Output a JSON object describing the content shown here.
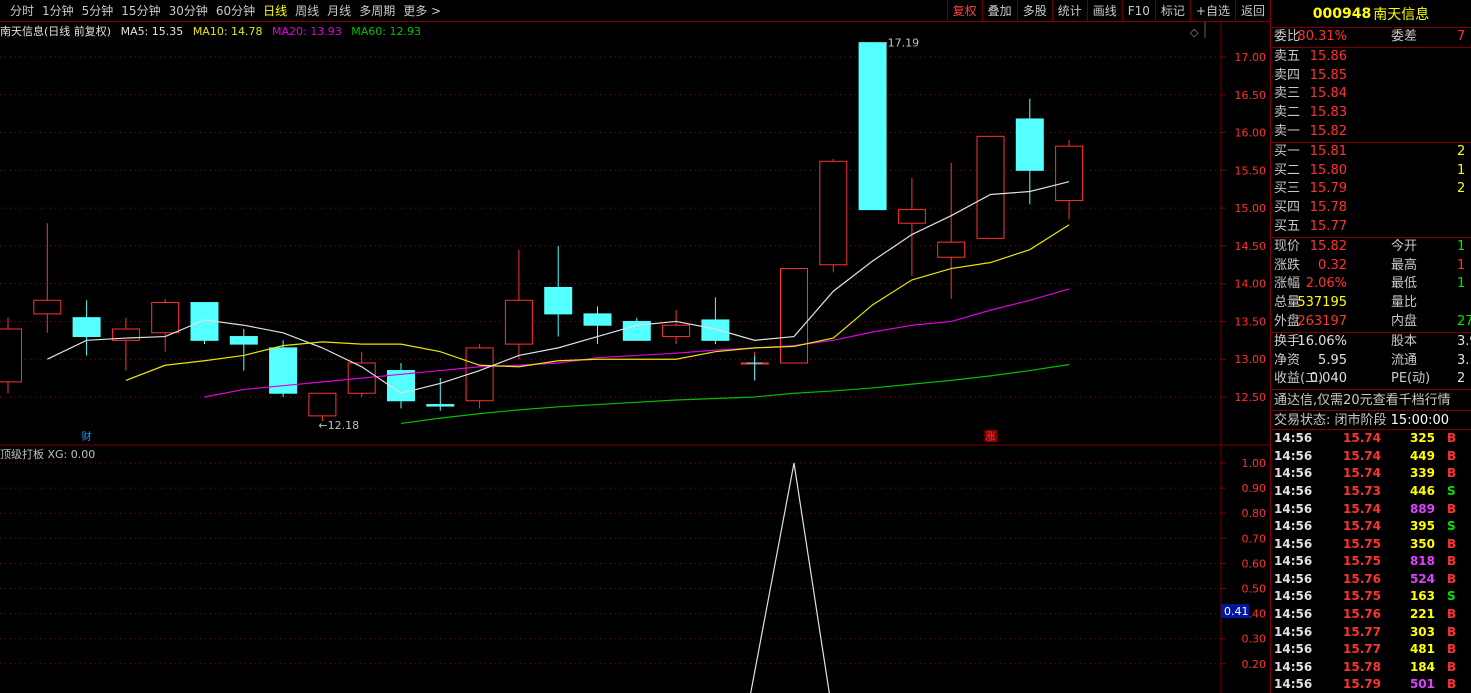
{
  "toolbar": {
    "periods": [
      {
        "label": "分时",
        "active": false
      },
      {
        "label": "1分钟",
        "active": false
      },
      {
        "label": "5分钟",
        "active": false
      },
      {
        "label": "15分钟",
        "active": false
      },
      {
        "label": "30分钟",
        "active": false
      },
      {
        "label": "60分钟",
        "active": false
      },
      {
        "label": "日线",
        "active": true
      },
      {
        "label": "周线",
        "active": false
      },
      {
        "label": "月线",
        "active": false
      },
      {
        "label": "多周期",
        "active": false
      },
      {
        "label": "更多 >",
        "active": false
      }
    ],
    "tools": [
      {
        "label": "复权",
        "active": true
      },
      {
        "label": "叠加",
        "active": false
      },
      {
        "label": "多股",
        "active": false
      },
      {
        "label": "统计",
        "active": false
      },
      {
        "label": "画线",
        "active": false
      },
      {
        "label": "F10",
        "active": false
      },
      {
        "label": "标记",
        "active": false
      },
      {
        "label": "+自选",
        "active": false
      },
      {
        "label": "返回",
        "active": false
      }
    ]
  },
  "legend": {
    "title": "南天信息(日线 前复权)",
    "ma5": "MA5: 15.35",
    "ma10": "MA10: 14.78",
    "ma20": "MA20: 13.93",
    "ma60": "MA60: 12.93"
  },
  "sub_legend": {
    "title": "顶级打板",
    "value": "XG: 0.00"
  },
  "colors": {
    "up": "#ff3232",
    "down": "#54ffff",
    "ma5": "#e0e0e0",
    "ma10": "#e6e600",
    "ma20": "#e000e0",
    "ma60": "#00c000",
    "axis_border": "#800000",
    "grid": "#8c0000"
  },
  "chart_data": [
    {
      "type": "candlestick",
      "title": "南天信息(日线 前复权)",
      "ylim": [
        12.0,
        17.3
      ],
      "yticks": [
        "17.00",
        "16.50",
        "16.00",
        "15.50",
        "15.00",
        "14.50",
        "14.00",
        "13.50",
        "13.00",
        "12.50"
      ],
      "candles": [
        {
          "o": 12.7,
          "h": 13.55,
          "l": 12.55,
          "c": 13.4
        },
        {
          "o": 13.6,
          "h": 14.8,
          "l": 13.35,
          "c": 13.78
        },
        {
          "o": 13.55,
          "h": 13.78,
          "l": 13.05,
          "c": 13.3
        },
        {
          "o": 13.25,
          "h": 13.55,
          "l": 12.85,
          "c": 13.4
        },
        {
          "o": 13.35,
          "h": 13.8,
          "l": 13.1,
          "c": 13.75
        },
        {
          "o": 13.75,
          "h": 13.75,
          "l": 13.2,
          "c": 13.25
        },
        {
          "o": 13.3,
          "h": 13.4,
          "l": 12.85,
          "c": 13.2
        },
        {
          "o": 13.15,
          "h": 13.25,
          "l": 12.5,
          "c": 12.55
        },
        {
          "o": 12.25,
          "h": 12.55,
          "l": 12.18,
          "c": 12.55
        },
        {
          "o": 12.55,
          "h": 13.1,
          "l": 12.5,
          "c": 12.95
        },
        {
          "o": 12.85,
          "h": 12.95,
          "l": 12.35,
          "c": 12.45
        },
        {
          "o": 12.4,
          "h": 12.75,
          "l": 12.32,
          "c": 12.38
        },
        {
          "o": 12.45,
          "h": 13.2,
          "l": 12.35,
          "c": 13.15
        },
        {
          "o": 13.2,
          "h": 14.45,
          "l": 13.0,
          "c": 13.78
        },
        {
          "o": 13.95,
          "h": 14.5,
          "l": 13.3,
          "c": 13.6
        },
        {
          "o": 13.6,
          "h": 13.7,
          "l": 13.2,
          "c": 13.45
        },
        {
          "o": 13.5,
          "h": 13.55,
          "l": 13.25,
          "c": 13.25
        },
        {
          "o": 13.3,
          "h": 13.65,
          "l": 13.2,
          "c": 13.45
        },
        {
          "o": 13.52,
          "h": 13.82,
          "l": 13.2,
          "c": 13.25
        },
        {
          "o": 12.95,
          "h": 13.1,
          "l": 12.72,
          "c": 12.95
        },
        {
          "o": 12.95,
          "h": 14.2,
          "l": 12.95,
          "c": 14.2
        },
        {
          "o": 14.25,
          "h": 15.65,
          "l": 14.15,
          "c": 15.62
        },
        {
          "o": 17.19,
          "h": 17.19,
          "l": 14.98,
          "c": 14.98
        },
        {
          "o": 14.8,
          "h": 15.4,
          "l": 14.1,
          "c": 14.98
        },
        {
          "o": 14.35,
          "h": 15.6,
          "l": 13.8,
          "c": 14.55
        },
        {
          "o": 14.6,
          "h": 15.95,
          "l": 14.6,
          "c": 15.95
        },
        {
          "o": 16.18,
          "h": 16.45,
          "l": 15.05,
          "c": 15.5
        },
        {
          "o": 15.1,
          "h": 15.9,
          "l": 14.85,
          "c": 15.82
        }
      ],
      "ma5": [
        13.0,
        13.25,
        13.28,
        13.3,
        13.52,
        13.45,
        13.35,
        13.15,
        12.9,
        12.55,
        12.68,
        12.85,
        13.05,
        13.15,
        13.3,
        13.45,
        13.5,
        13.4,
        13.25,
        13.3,
        13.9,
        14.3,
        14.65,
        14.9,
        15.18,
        15.22,
        15.35
      ],
      "ma10": [
        12.72,
        12.92,
        12.98,
        13.05,
        13.18,
        13.23,
        13.2,
        13.2,
        13.1,
        12.92,
        12.9,
        12.98,
        13.0,
        13.0,
        13.0,
        13.1,
        13.15,
        13.17,
        13.28,
        13.72,
        14.05,
        14.2,
        14.28,
        14.45,
        14.78
      ],
      "ma20": [
        12.5,
        12.6,
        12.65,
        12.7,
        12.75,
        12.8,
        12.85,
        12.9,
        12.92,
        12.95,
        13.02,
        13.05,
        13.08,
        13.12,
        13.15,
        13.18,
        13.25,
        13.36,
        13.45,
        13.5,
        13.65,
        13.78,
        13.93
      ],
      "ma60": [
        12.15,
        12.22,
        12.28,
        12.33,
        12.37,
        12.4,
        12.43,
        12.46,
        12.48,
        12.5,
        12.55,
        12.58,
        12.62,
        12.67,
        12.72,
        12.78,
        12.85,
        12.93
      ],
      "annotations": [
        "17.19",
        "12.18"
      ],
      "markers": [
        "财",
        "涨"
      ]
    },
    {
      "type": "line",
      "title": "顶级打板",
      "ylim": [
        0,
        1.05
      ],
      "yticks": [
        "1.00",
        "0.90",
        "0.80",
        "0.70",
        "0.60",
        "0.50",
        "0.40",
        "0.30",
        "0.20"
      ],
      "current_value_label": "0.41",
      "series": [
        {
          "name": "XG",
          "peak_index": 20,
          "peak_value": 1.0
        }
      ]
    }
  ],
  "panel": {
    "code": "000948",
    "name": "南天信息",
    "weibi": {
      "label": "委比",
      "value": "80.31%",
      "label2": "委差",
      "value2": "7"
    },
    "sells": [
      {
        "label": "卖五",
        "price": "15.86"
      },
      {
        "label": "卖四",
        "price": "15.85"
      },
      {
        "label": "卖三",
        "price": "15.84"
      },
      {
        "label": "卖二",
        "price": "15.83"
      },
      {
        "label": "卖一",
        "price": "15.82"
      }
    ],
    "buys": [
      {
        "label": "买一",
        "price": "15.81",
        "vol": "2"
      },
      {
        "label": "买二",
        "price": "15.80",
        "vol": "1"
      },
      {
        "label": "买三",
        "price": "15.79",
        "vol": "2"
      },
      {
        "label": "买四",
        "price": "15.78",
        "vol": ""
      },
      {
        "label": "买五",
        "price": "15.77",
        "vol": ""
      }
    ],
    "quote": [
      {
        "l": "现价",
        "v": "15.82",
        "vc": "red",
        "l2": "今开",
        "v2": "1",
        "v2c": "green"
      },
      {
        "l": "涨跌",
        "v": "0.32",
        "vc": "red",
        "l2": "最高",
        "v2": "1",
        "v2c": "red"
      },
      {
        "l": "涨幅",
        "v": "2.06%",
        "vc": "red",
        "l2": "最低",
        "v2": "1",
        "v2c": "green"
      },
      {
        "l": "总量",
        "v": "537195",
        "vc": "yellow",
        "l2": "量比",
        "v2": "",
        "v2c": "red"
      },
      {
        "l": "外盘",
        "v": "263197",
        "vc": "red",
        "l2": "内盘",
        "v2": "27",
        "v2c": "green"
      }
    ],
    "stats": [
      {
        "l": "换手",
        "v": "16.06%",
        "vc": "white",
        "l2": "股本",
        "v2": "3.9",
        "v2c": "white"
      },
      {
        "l": "净资",
        "v": "5.95",
        "vc": "white",
        "l2": "流通",
        "v2": "3.",
        "v2c": "white"
      },
      {
        "l": "收益(二)",
        "v": "0.040",
        "vc": "white",
        "l2": "PE(动)",
        "v2": "2",
        "v2c": "white"
      }
    ],
    "ad": "通达信,仅需20元查看千档行情",
    "state_label": "交易状态: 闭市阶段",
    "state_time": "15:00:00",
    "ticks": [
      {
        "t": "14:56",
        "p": "15.74",
        "q": "325",
        "s": "B",
        "qc": "yellow",
        "pc": "red",
        "sc": "red"
      },
      {
        "t": "14:56",
        "p": "15.74",
        "q": "449",
        "s": "B",
        "qc": "yellow",
        "pc": "red",
        "sc": "red"
      },
      {
        "t": "14:56",
        "p": "15.74",
        "q": "339",
        "s": "B",
        "qc": "yellow",
        "pc": "red",
        "sc": "red"
      },
      {
        "t": "14:56",
        "p": "15.73",
        "q": "446",
        "s": "S",
        "qc": "yellow",
        "pc": "red",
        "sc": "green"
      },
      {
        "t": "14:56",
        "p": "15.74",
        "q": "889",
        "s": "B",
        "qc": "magenta",
        "pc": "red",
        "sc": "red"
      },
      {
        "t": "14:56",
        "p": "15.74",
        "q": "395",
        "s": "S",
        "qc": "yellow",
        "pc": "red",
        "sc": "green"
      },
      {
        "t": "14:56",
        "p": "15.75",
        "q": "350",
        "s": "B",
        "qc": "yellow",
        "pc": "red",
        "sc": "red"
      },
      {
        "t": "14:56",
        "p": "15.75",
        "q": "818",
        "s": "B",
        "qc": "magenta",
        "pc": "red",
        "sc": "red"
      },
      {
        "t": "14:56",
        "p": "15.76",
        "q": "524",
        "s": "B",
        "qc": "magenta",
        "pc": "red",
        "sc": "red"
      },
      {
        "t": "14:56",
        "p": "15.75",
        "q": "163",
        "s": "S",
        "qc": "yellow",
        "pc": "red",
        "sc": "green"
      },
      {
        "t": "14:56",
        "p": "15.76",
        "q": "221",
        "s": "B",
        "qc": "yellow",
        "pc": "red",
        "sc": "red"
      },
      {
        "t": "14:56",
        "p": "15.77",
        "q": "303",
        "s": "B",
        "qc": "yellow",
        "pc": "red",
        "sc": "red"
      },
      {
        "t": "14:56",
        "p": "15.77",
        "q": "481",
        "s": "B",
        "qc": "yellow",
        "pc": "red",
        "sc": "red"
      },
      {
        "t": "14:56",
        "p": "15.78",
        "q": "184",
        "s": "B",
        "qc": "yellow",
        "pc": "red",
        "sc": "red"
      },
      {
        "t": "14:56",
        "p": "15.79",
        "q": "501",
        "s": "B",
        "qc": "magenta",
        "pc": "red",
        "sc": "red"
      }
    ]
  }
}
